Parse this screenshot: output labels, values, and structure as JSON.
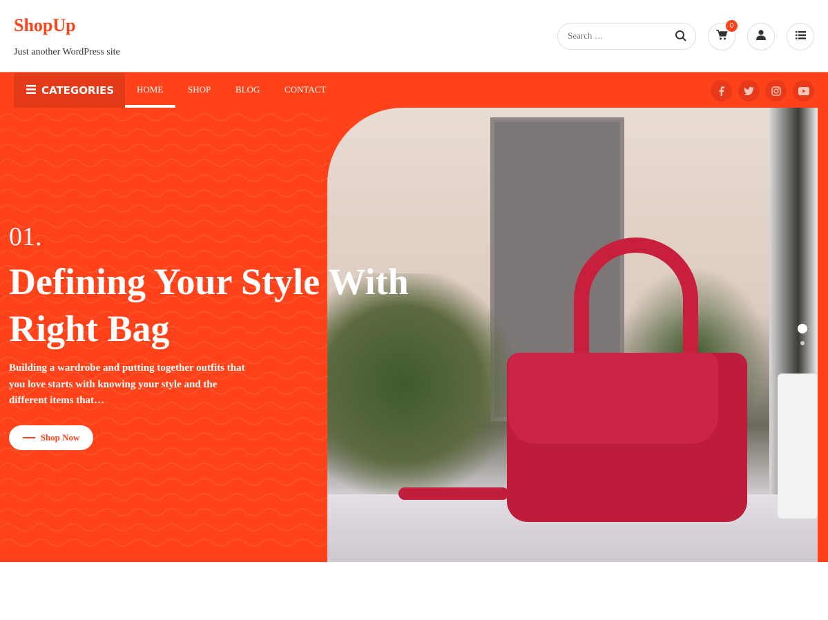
{
  "site": {
    "title": "ShopUp",
    "tagline": "Just another WordPress site"
  },
  "search": {
    "placeholder": "Search …"
  },
  "cart": {
    "count": "0"
  },
  "nav": {
    "categories_label": "CATEGORIES",
    "items": [
      {
        "label": "HOME",
        "active": true
      },
      {
        "label": "SHOP"
      },
      {
        "label": "BLOG"
      },
      {
        "label": "CONTACT"
      }
    ]
  },
  "social": [
    "facebook-icon",
    "twitter-icon",
    "instagram-icon",
    "youtube-icon"
  ],
  "hero": {
    "number": "01.",
    "title": "Defining Your Style With Right Bag",
    "description": "Building a wardrobe and putting together outfits that you love starts with knowing your style and the different items that…",
    "button_label": "Shop Now",
    "slides": 2,
    "active_slide": 1
  },
  "colors": {
    "accent": "#ff4219",
    "accent_dark": "#e33a17"
  }
}
